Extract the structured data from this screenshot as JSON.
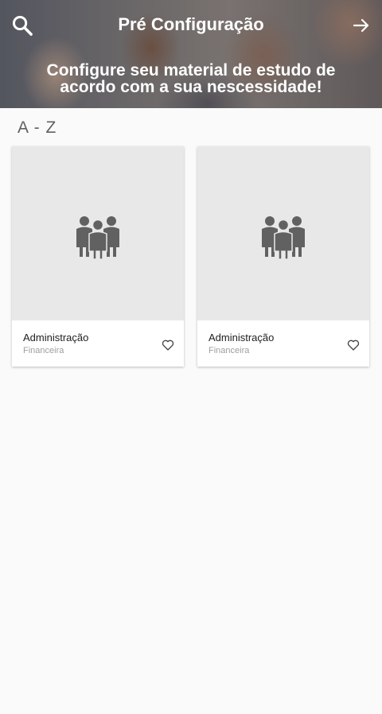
{
  "header": {
    "title": "Pré Configuração",
    "subtitle": "Configure seu material de estudo de acordo com a sua nescessidade!",
    "icons": {
      "left": "search-icon",
      "right": "arrow-right-icon"
    }
  },
  "section": {
    "title": "A - Z"
  },
  "cards": [
    {
      "name": "Administração",
      "subtitle": "Financeira",
      "icon": "people-group-icon",
      "favorite_icon": "heart-outline-icon"
    },
    {
      "name": "Administração",
      "subtitle": "Financeira",
      "icon": "people-group-icon",
      "favorite_icon": "heart-outline-icon"
    }
  ],
  "colors": {
    "background": "#fafafa",
    "card_image_bg": "#e8e8e8",
    "icon_gray": "#616161"
  }
}
